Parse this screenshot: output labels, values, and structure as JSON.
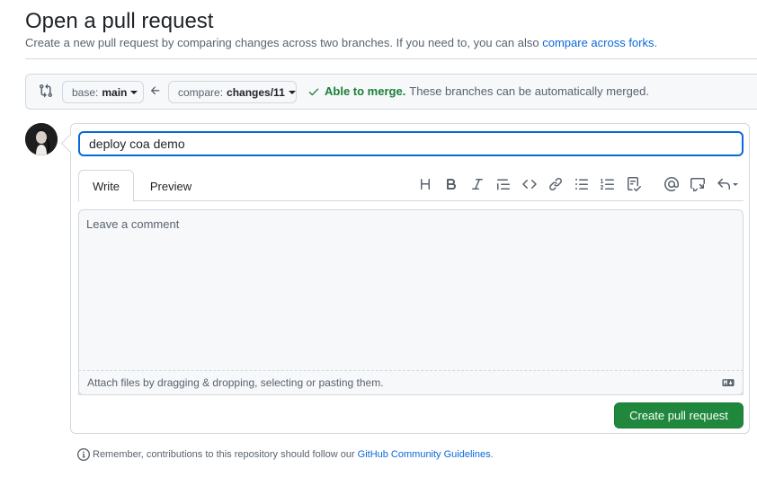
{
  "header": {
    "title": "Open a pull request",
    "subtitle_text": "Create a new pull request by comparing changes across two branches. If you need to, you can also",
    "subtitle_link": "compare across forks",
    "subtitle_end": "."
  },
  "range": {
    "base_prefix": "base:",
    "base_branch": "main",
    "compare_prefix": "compare:",
    "compare_branch": "changes/11",
    "merge_ok": "Able to merge.",
    "merge_text": "These branches can be automatically merged."
  },
  "form": {
    "title_value": "deploy coa demo",
    "tabs": {
      "write": "Write",
      "preview": "Preview"
    },
    "toolbar_icons": [
      "heading-icon",
      "bold-icon",
      "italic-icon",
      "quote-icon",
      "code-icon",
      "link-icon",
      "unordered-list-icon",
      "ordered-list-icon",
      "task-list-icon",
      "mention-icon",
      "reference-icon",
      "reply-icon"
    ],
    "comment_placeholder": "Leave a comment",
    "attach_text": "Attach files by dragging & dropping, selecting or pasting them.",
    "submit_label": "Create pull request"
  },
  "footer": {
    "text": "Remember, contributions to this repository should follow our",
    "link": "GitHub Community Guidelines",
    "end": "."
  },
  "colors": {
    "accent_blue": "#0969da",
    "success_green": "#1a7f37",
    "button_green": "#1f883d",
    "border": "#d1d9e0",
    "muted_text": "#59636e"
  }
}
